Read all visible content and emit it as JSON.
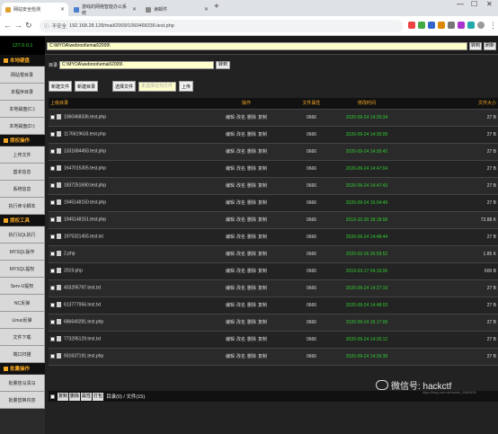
{
  "tabs": [
    {
      "label": "网站安全检测",
      "active": true
    },
    {
      "label": "游戏的网络智能办公系统",
      "active": false
    },
    {
      "label": "读邮件",
      "active": false
    }
  ],
  "addressbar": {
    "security": "不安全",
    "url": "192.168.28.128/mail/2009/1060468336.test.php"
  },
  "app": {
    "ip": "127.0.0.1",
    "path_value": "C:\\MYOA\\webroot\\email\\2009\\",
    "top_buttons": [
      "转到",
      "刷新"
    ],
    "dir_label": "目录",
    "dir_value": "C:\\MYOA\\webroot\\email\\2009\\",
    "dir_button": "转到",
    "toolbar": {
      "new_file": "新建文件",
      "new_dir": "新建目录",
      "choose_file": "选择文件",
      "file_placeholder": "未选择任何文件",
      "upload": "上传"
    }
  },
  "sidebar": [
    {
      "type": "head",
      "label": "本地硬盘"
    },
    {
      "type": "item",
      "label": "网站根目录"
    },
    {
      "type": "item",
      "label": "本程序目录"
    },
    {
      "type": "item",
      "label": "本地磁盘(C:)"
    },
    {
      "type": "item",
      "label": "本地磁盘(D:)"
    },
    {
      "type": "head",
      "label": "提权操作"
    },
    {
      "type": "item",
      "label": "上传文件"
    },
    {
      "type": "item",
      "label": "基本信息"
    },
    {
      "type": "item",
      "label": "系统信息"
    },
    {
      "type": "item",
      "label": "执行命令脚本"
    },
    {
      "type": "head",
      "label": "提权工具"
    },
    {
      "type": "item",
      "label": "执行SQL执行"
    },
    {
      "type": "item",
      "label": "MYSQL操作"
    },
    {
      "type": "item",
      "label": "MYSQL提权"
    },
    {
      "type": "item",
      "label": "Serv-U提权"
    },
    {
      "type": "item",
      "label": "NC反弹"
    },
    {
      "type": "item",
      "label": "Linux反弹"
    },
    {
      "type": "item",
      "label": "文件下载"
    },
    {
      "type": "item",
      "label": "端口扫描"
    },
    {
      "type": "head",
      "label": "批量操作"
    },
    {
      "type": "item",
      "label": "批量挂马清马"
    },
    {
      "type": "item",
      "label": "批量替换内容"
    }
  ],
  "table": {
    "headers": [
      "上级目录",
      "操作",
      "文件属性",
      "修改时间",
      "文件大小"
    ],
    "rows": [
      {
        "name": "1060468336.test.php",
        "ops": [
          "编辑",
          "改名",
          "删除",
          "复制"
        ],
        "attr": "0666",
        "time": "2020-09-24 14:26:34",
        "size": "27 B"
      },
      {
        "name": "1176619633.test.php",
        "ops": [
          "编辑",
          "改名",
          "删除",
          "复制"
        ],
        "attr": "0666",
        "time": "2020-09-24 14:30:09",
        "size": "27 B"
      },
      {
        "name": "1331684493.test.php",
        "ops": [
          "编辑",
          "改名",
          "删除",
          "复制"
        ],
        "attr": "0666",
        "time": "2020-09-24 14:26:42",
        "size": "27 B"
      },
      {
        "name": "1647015305.test.php",
        "ops": [
          "编辑",
          "改名",
          "删除",
          "复制"
        ],
        "attr": "0666",
        "time": "2020-09-24 14:47:04",
        "size": "27 B"
      },
      {
        "name": "1837251690.test.php",
        "ops": [
          "编辑",
          "改名",
          "删除",
          "复制"
        ],
        "attr": "0666",
        "time": "2020-09-24 14:47:43",
        "size": "27 B"
      },
      {
        "name": "1945148150.test.php",
        "ops": [
          "编辑",
          "改名",
          "删除",
          "复制"
        ],
        "attr": "0666",
        "time": "2020-09-24 15:04:49",
        "size": "27 B"
      },
      {
        "name": "1945148151.test.php",
        "ops": [
          "编辑",
          "改名",
          "删除",
          "复制"
        ],
        "attr": "0666",
        "time": "2019-10-30 18:18:58",
        "size": "73.88 K"
      },
      {
        "name": "1975321455.test.txt",
        "ops": [
          "编辑",
          "改名",
          "删除",
          "复制"
        ],
        "attr": "0666",
        "time": "2020-09-24 14:48:44",
        "size": "27 B"
      },
      {
        "name": "2.php",
        "ops": [
          "编辑",
          "改名",
          "删除",
          "复制"
        ],
        "attr": "0666",
        "time": "2020-02-26 20:59:52",
        "size": "1.85 K"
      },
      {
        "name": "2019.php",
        "ops": [
          "编辑",
          "改名",
          "删除",
          "复制"
        ],
        "attr": "0666",
        "time": "2019-03-17 04:19:06",
        "size": "600 B"
      },
      {
        "name": "403295797.test.txt",
        "ops": [
          "编辑",
          "改名",
          "删除",
          "复制"
        ],
        "attr": "0666",
        "time": "2020-09-24 14:27:19",
        "size": "27 B"
      },
      {
        "name": "613777956.test.txt",
        "ops": [
          "编辑",
          "改名",
          "删除",
          "复制"
        ],
        "attr": "0666",
        "time": "2020-09-24 14:48:03",
        "size": "27 B"
      },
      {
        "name": "686640281.test.php",
        "ops": [
          "编辑",
          "改名",
          "删除",
          "复制"
        ],
        "attr": "0666",
        "time": "2020-09-24 15:17:09",
        "size": "27 B"
      },
      {
        "name": "773295129.test.txt",
        "ops": [
          "编辑",
          "改名",
          "删除",
          "复制"
        ],
        "attr": "0666",
        "time": "2020-09-24 14:26:12",
        "size": "27 B"
      },
      {
        "name": "931637191.test.php",
        "ops": [
          "编辑",
          "改名",
          "删除",
          "复制"
        ],
        "attr": "0666",
        "time": "2020-09-24 14:26:38",
        "size": "27 B"
      }
    ]
  },
  "footer": {
    "buttons": [
      "复制",
      "删除",
      "属性",
      "打包"
    ],
    "summary": "目录(0) / 文件(15)"
  },
  "watermark": {
    "label": "微信号: hackctf",
    "small_url": "https://blog.csdn.net/weixin_43669159"
  },
  "colors": {
    "accent": "#f5a623",
    "time_green": "#33cc33",
    "input_bg": "#ffffcc"
  }
}
